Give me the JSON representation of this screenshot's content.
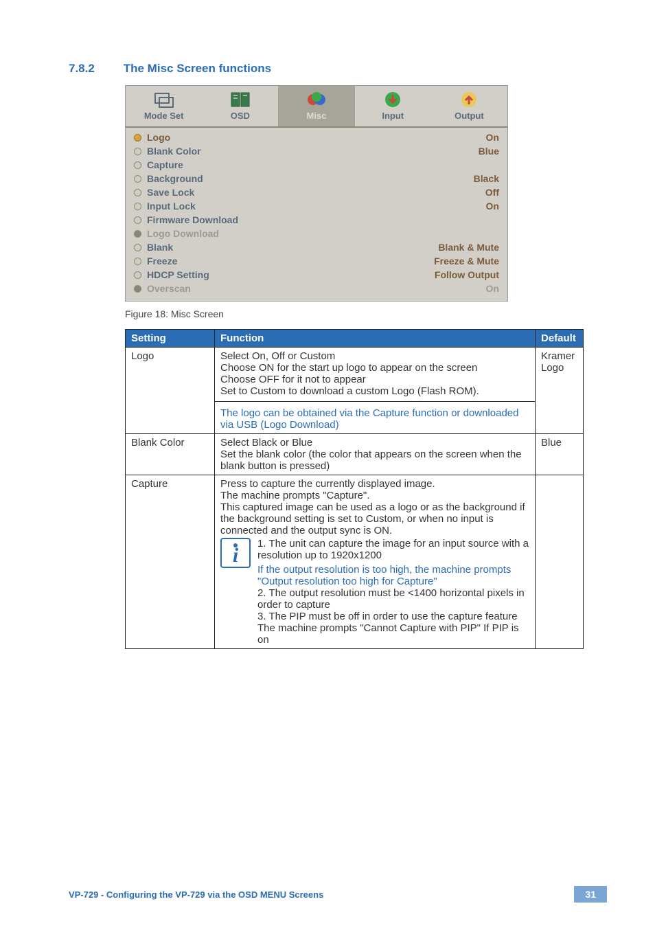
{
  "section": {
    "number": "7.8.2",
    "title": "The Misc Screen functions"
  },
  "osd": {
    "tabs": [
      {
        "label": "Mode Set",
        "active": false
      },
      {
        "label": "OSD",
        "active": false
      },
      {
        "label": "Misc",
        "active": true
      },
      {
        "label": "Input",
        "active": false
      },
      {
        "label": "Output",
        "active": false
      }
    ],
    "rows": [
      {
        "label": "Logo",
        "value": "On",
        "hl": true,
        "dim": false
      },
      {
        "label": "Blank Color",
        "value": "Blue",
        "hl": false,
        "dim": false
      },
      {
        "label": "Capture",
        "value": "",
        "hl": false,
        "dim": false
      },
      {
        "label": "Background",
        "value": "Black",
        "hl": false,
        "dim": false
      },
      {
        "label": "Save Lock",
        "value": "Off",
        "hl": false,
        "dim": false
      },
      {
        "label": "Input Lock",
        "value": "On",
        "hl": false,
        "dim": false
      },
      {
        "label": "Firmware Download",
        "value": "",
        "hl": false,
        "dim": false
      },
      {
        "label": "Logo Download",
        "value": "",
        "hl": false,
        "dim": true
      },
      {
        "label": "Blank",
        "value": "Blank & Mute",
        "hl": false,
        "dim": false
      },
      {
        "label": "Freeze",
        "value": "Freeze & Mute",
        "hl": false,
        "dim": false
      },
      {
        "label": "HDCP Setting",
        "value": "Follow Output",
        "hl": false,
        "dim": false
      },
      {
        "label": "Overscan",
        "value": "On",
        "hl": false,
        "dim": true
      }
    ]
  },
  "figure_caption": "Figure 18: Misc Screen",
  "table": {
    "headers": {
      "setting": "Setting",
      "function": "Function",
      "default": "Default"
    },
    "rows": [
      {
        "setting": "Logo",
        "function_main": "Select On, Off or Custom\nChoose ON for the start up logo to appear on the screen\nChoose OFF for it not to appear\nSet to Custom to download a custom Logo (Flash ROM).",
        "function_note": "The logo can be obtained via the Capture function or downloaded via USB (Logo Download)",
        "default": "Kramer Logo"
      },
      {
        "setting": "Blank Color",
        "function_main": "Select Black or Blue\nSet the blank color (the color that appears on the screen when the blank button is pressed)",
        "default": "Blue"
      },
      {
        "setting": "Capture",
        "function_intro": "Press to capture the currently displayed image.\nThe machine prompts \"Capture\".\nThis captured image can be used as a logo or as the background if the background setting is set to Custom, or when no input is connected and the output sync is ON.",
        "info_line1": "1. The unit can capture the image for an input source with a resolution up to 1920x1200",
        "info_note": "If the output resolution is too high, the machine prompts \"Output resolution too high for Capture\"",
        "info_line2": "2. The output resolution must be <1400 horizontal pixels in order to capture",
        "info_line3": "3. The PIP must be off in order to use the capture feature",
        "info_line4": "The machine prompts \"Cannot Capture with PIP\" If PIP is on",
        "default": ""
      }
    ]
  },
  "footer": {
    "text": "VP-729 - Configuring the VP-729 via the OSD MENU Screens",
    "page": "31"
  }
}
